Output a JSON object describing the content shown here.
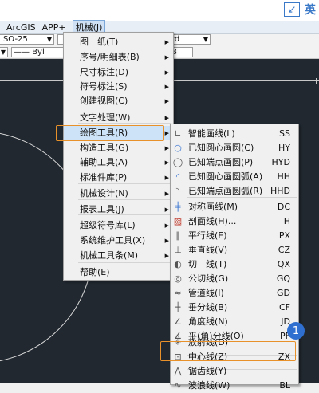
{
  "ime": {
    "icon_symbol": "↙",
    "lang": "英"
  },
  "menubar": {
    "items": [
      "ArcGIS",
      "APP+",
      "机械(J)"
    ]
  },
  "toolbar": {
    "dimstyle": "ISO-25",
    "rd_text": "rd",
    "linetype": "—— Byl",
    "b_text": "B"
  },
  "menu1": {
    "items": [
      {
        "label": "图　纸(T)",
        "sub": true
      },
      {
        "label": "序号/明细表(B)",
        "sub": true
      },
      {
        "label": "尺寸标注(D)",
        "sub": true
      },
      {
        "label": "符号标注(S)",
        "sub": true
      },
      {
        "label": "创建视图(C)",
        "sub": true
      },
      {
        "label": "文字处理(W)",
        "sub": true
      },
      {
        "label": "绘图工具(R)",
        "sub": true
      },
      {
        "label": "构造工具(G)",
        "sub": true
      },
      {
        "label": "辅助工具(A)",
        "sub": true
      },
      {
        "label": "标准件库(P)",
        "sub": true
      },
      {
        "label": "机械设计(N)",
        "sub": true
      },
      {
        "label": "报表工具(J)",
        "sub": true
      },
      {
        "label": "超级符号库(L)",
        "sub": true
      },
      {
        "label": "系统维护工具(X)",
        "sub": true
      },
      {
        "label": "机械工具条(M)",
        "sub": true
      },
      {
        "label": "帮助(E)",
        "sub": false
      }
    ]
  },
  "menu2": {
    "items": [
      {
        "label": "智能画线(L)",
        "shortcut": "SS",
        "icon": "smart-line-icon"
      },
      {
        "label": "已知圆心画圆(C)",
        "shortcut": "HY",
        "icon": "circle-center-icon"
      },
      {
        "label": "已知端点画圆(P)",
        "shortcut": "HYD",
        "icon": "circle-endpoint-icon"
      },
      {
        "label": "已知圆心画圆弧(A)",
        "shortcut": "HH",
        "icon": "arc-center-icon"
      },
      {
        "label": "已知端点画圆弧(R)",
        "shortcut": "HHD",
        "icon": "arc-endpoint-icon"
      },
      {
        "label": "对称画线(M)",
        "shortcut": "DC",
        "icon": "symmetric-line-icon"
      },
      {
        "label": "剖面线(H)...",
        "shortcut": "H",
        "icon": "hatch-icon"
      },
      {
        "label": "平行线(E)",
        "shortcut": "PX",
        "icon": "parallel-line-icon"
      },
      {
        "label": "垂直线(V)",
        "shortcut": "CZ",
        "icon": "perpendicular-line-icon"
      },
      {
        "label": "切　线(T)",
        "shortcut": "QX",
        "icon": "tangent-line-icon"
      },
      {
        "label": "公切线(G)",
        "shortcut": "GQ",
        "icon": "common-tangent-icon"
      },
      {
        "label": "管道线(I)",
        "shortcut": "GD",
        "icon": "pipe-line-icon"
      },
      {
        "label": "垂分线(B)",
        "shortcut": "CF",
        "icon": "perpendicular-bisector-icon"
      },
      {
        "label": "角度线(N)",
        "shortcut": "JD",
        "icon": "angle-line-icon"
      },
      {
        "label": "平(角)分线(O)",
        "shortcut": "PF",
        "icon": "angle-bisector-icon"
      },
      {
        "label": "放射线(D)",
        "shortcut": "",
        "icon": "radial-line-icon"
      },
      {
        "label": "中心线(Z)",
        "shortcut": "ZX",
        "icon": "center-line-icon"
      },
      {
        "label": "锯齿线(Y)",
        "shortcut": "",
        "icon": "zigzag-line-icon"
      },
      {
        "label": "波浪线(W)",
        "shortcut": "BL",
        "icon": "wave-line-icon"
      }
    ]
  },
  "badge": {
    "number": "1"
  },
  "colors": {
    "highlight_orange": "#e8902a",
    "badge_blue": "#2f6fd0",
    "canvas": "#212830"
  }
}
